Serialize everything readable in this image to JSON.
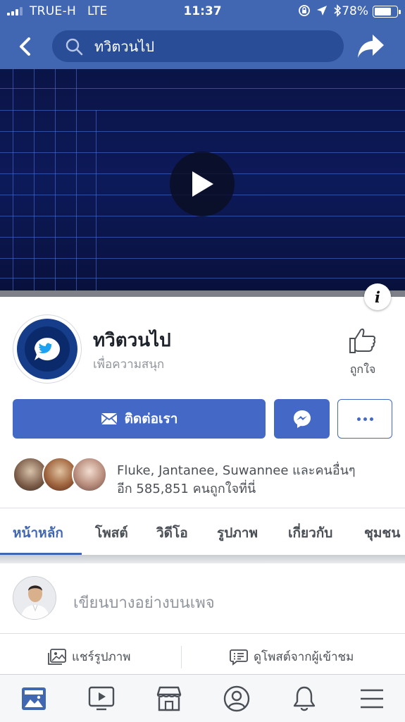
{
  "status_bar": {
    "carrier": "TRUE-H",
    "network": "LTE",
    "time": "11:37",
    "battery_percent": "78%",
    "battery_level": 0.78
  },
  "header": {
    "search_value": "ทวิตวนไป",
    "icons": [
      "back-arrow-icon",
      "search-icon",
      "share-icon"
    ]
  },
  "cover": {
    "media_type": "video",
    "icons": [
      "play-icon",
      "info-icon"
    ],
    "info_label": "i"
  },
  "page": {
    "name": "ทวิตวนไป",
    "category": "เพื่อความสนุก",
    "like_label": "ถูกใจ"
  },
  "buttons": {
    "contact_label": "ติดต่อเรา",
    "messenger_icon": "messenger-icon",
    "more_icon": "more-dots-icon"
  },
  "likes": {
    "friends_line": "Fluke, Jantanee, Suwannee และคนอื่นๆ",
    "count_line": "อีก 585,851 คนถูกใจที่นี่"
  },
  "tabs": [
    {
      "label": "หน้าหลัก",
      "active": true
    },
    {
      "label": "โพสต์",
      "active": false
    },
    {
      "label": "วิดีโอ",
      "active": false
    },
    {
      "label": "รูปภาพ",
      "active": false
    },
    {
      "label": "เกี่ยวกับ",
      "active": false
    },
    {
      "label": "ชุมชน",
      "active": false
    }
  ],
  "composer": {
    "placeholder": "เขียนบางอย่างบนเพจ",
    "share_photo_label": "แชร์รูปภาพ",
    "visitor_posts_label": "ดูโพสต์จากผู้เข้าชม"
  },
  "bottom_nav": [
    {
      "icon": "news-feed-icon",
      "active": true
    },
    {
      "icon": "watch-icon",
      "active": false
    },
    {
      "icon": "marketplace-icon",
      "active": false
    },
    {
      "icon": "profile-icon",
      "active": false
    },
    {
      "icon": "notifications-icon",
      "active": false
    },
    {
      "icon": "menu-icon",
      "active": false
    }
  ],
  "colors": {
    "brand_blue": "#4166b2",
    "button_blue": "#4468c5",
    "active_tab": "#4267b2",
    "text_secondary": "#90949c"
  }
}
